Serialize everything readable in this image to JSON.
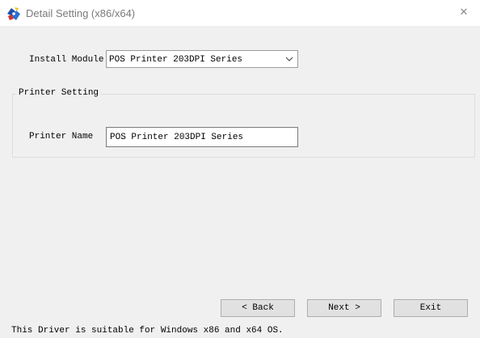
{
  "window": {
    "title": "Detail Setting (x86/x64)",
    "app_icon": "driver-setup-icon",
    "close_icon": "close-icon",
    "close_glyph": "✕"
  },
  "install_module": {
    "label": "Install Module",
    "selected": "POS Printer 203DPI  Series",
    "dropdown_icon": "chevron-down-icon"
  },
  "printer_setting": {
    "group_title": "Printer Setting",
    "printer_name_label": "Printer Name",
    "printer_name_value": "POS Printer 203DPI  Series"
  },
  "buttons": {
    "back": "< Back",
    "next": "Next >",
    "exit": "Exit"
  },
  "footer": {
    "note": "This Driver is suitable for Windows x86 and x64 OS."
  },
  "colors": {
    "title_text": "#7a7a7a",
    "window_bg": "#f0f0f0",
    "titlebar_bg": "#ffffff",
    "button_bg": "#e1e1e1",
    "icon_blue": "#1f4fa8",
    "icon_red": "#d9302c",
    "icon_yellow": "#f2c230"
  }
}
